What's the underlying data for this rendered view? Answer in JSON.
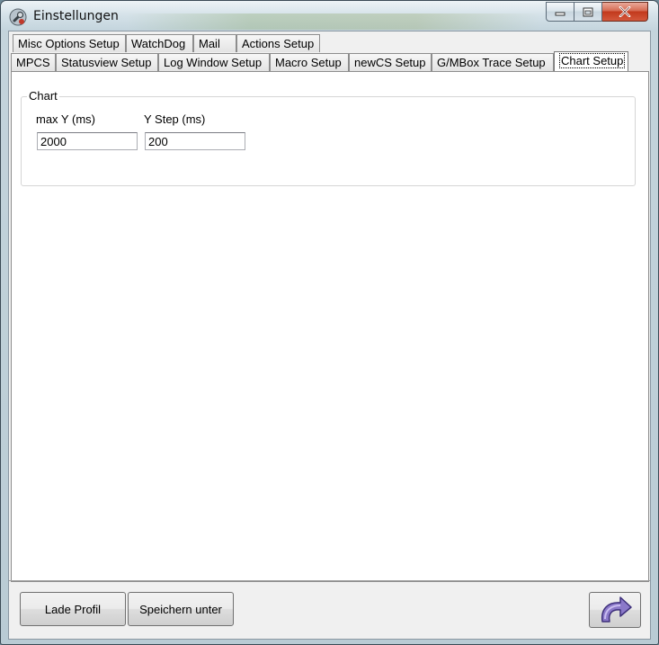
{
  "window": {
    "title": "Einstellungen"
  },
  "tabs": {
    "row_top": [
      "Misc Options Setup",
      "WatchDog",
      "Mail",
      "Actions Setup"
    ],
    "row_bottom": [
      "MPCS",
      "Statusview Setup",
      "Log Window Setup",
      "Macro Setup",
      "newCS Setup",
      "G/MBox Trace Setup",
      "Chart Setup"
    ],
    "active": "Chart Setup"
  },
  "chart_group": {
    "label": "Chart",
    "max_y_label": "max Y (ms)",
    "max_y_value": "2000",
    "y_step_label": "Y Step (ms)",
    "y_step_value": "200"
  },
  "buttons": {
    "load_profile": "Lade Profil",
    "save_as": "Speichern unter"
  },
  "icons": {
    "app": "wrench-icon",
    "apply": "curved-arrow-icon",
    "minimize": "minimize-icon",
    "maximize": "maximize-icon",
    "close": "close-icon"
  }
}
